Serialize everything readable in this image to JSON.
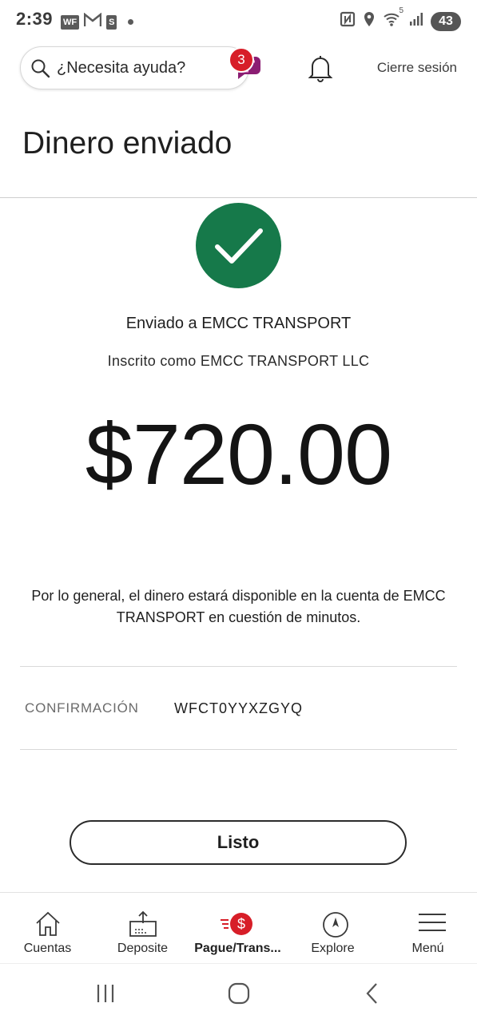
{
  "status_bar": {
    "time": "2:39",
    "left_icons": [
      "wf-notification-icon",
      "gmail-icon",
      "s-app-icon",
      "dot-icon"
    ],
    "left_labels": {
      "wf": "WF",
      "s": "S"
    },
    "right_icons": [
      "nfc-icon",
      "location-icon",
      "wifi-icon",
      "signal-icon"
    ],
    "wifi_label": "5",
    "battery": "43"
  },
  "header": {
    "search_placeholder": "¿Necesita ayuda?",
    "assistant_badge": "3",
    "logout_label": "Cierre sesión"
  },
  "page": {
    "title": "Dinero enviado"
  },
  "confirmation": {
    "sent_to": "Enviado a EMCC TRANSPORT",
    "enrolled_as": "Inscrito como EMCC TRANSPORT LLC",
    "amount": "$720.00",
    "note": "Por lo general, el dinero estará disponible en la cuenta de EMCC TRANSPORT en cuestión de minutos.",
    "confirmation_label": "CONFIRMACIÓN",
    "confirmation_value": "WFCT0YYXZGYQ",
    "done_label": "Listo"
  },
  "bottom_nav": {
    "items": [
      {
        "label": "Cuentas",
        "icon": "home-icon"
      },
      {
        "label": "Deposite",
        "icon": "deposit-icon"
      },
      {
        "label": "Pague/Trans...",
        "icon": "pay-transfer-icon"
      },
      {
        "label": "Explore",
        "icon": "compass-icon"
      },
      {
        "label": "Menú",
        "icon": "hamburger-menu-icon"
      }
    ],
    "active_index": 2
  },
  "colors": {
    "success_green": "#16794a",
    "brand_red": "#d71e28",
    "assistant_purple": "#8b1d73"
  }
}
